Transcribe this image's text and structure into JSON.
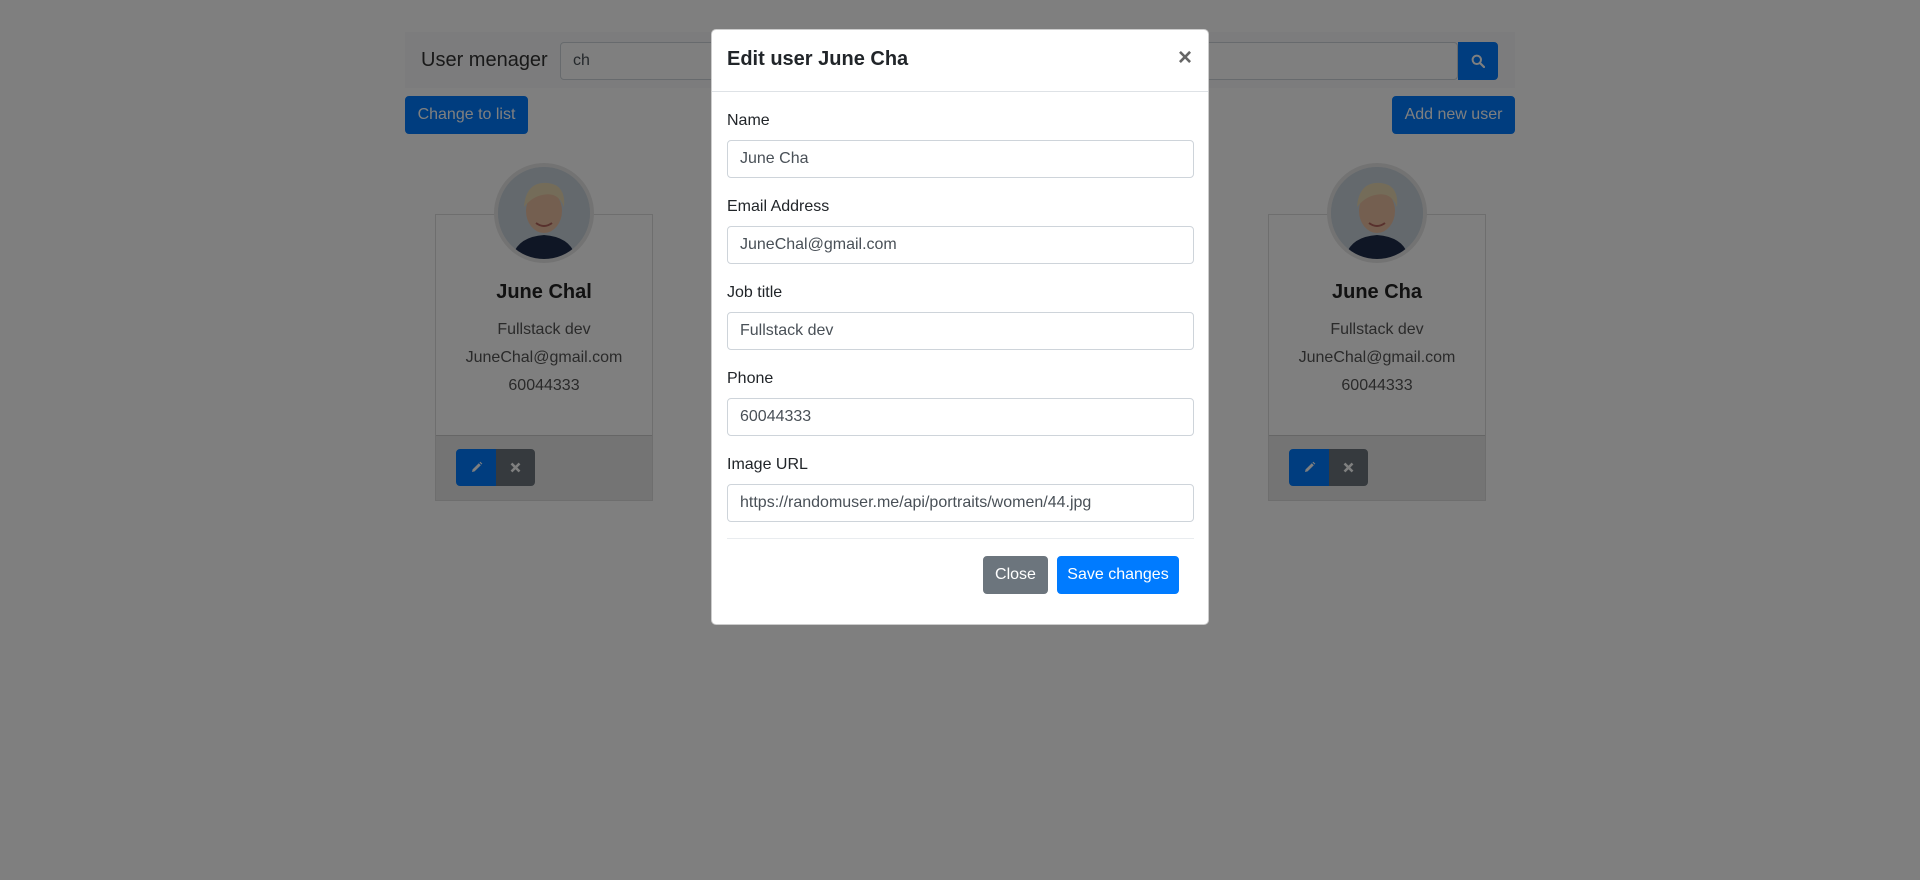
{
  "navbar": {
    "brand": "User menager",
    "search_value": "ch",
    "search_icon": "search-icon"
  },
  "actions": {
    "change_to_list": "Change to list",
    "add_new_user": "Add new user"
  },
  "cards": [
    {
      "name": "June Chal",
      "job": "Fullstack dev",
      "email": "JuneChal@gmail.com",
      "phone": "60044333",
      "edit_icon": "pencil-icon",
      "delete_icon": "times-icon"
    },
    {
      "name": "June Cha",
      "job": "Fullstack dev",
      "email": "JuneChal@gmail.com",
      "phone": "60044333",
      "edit_icon": "pencil-icon",
      "delete_icon": "times-icon"
    }
  ],
  "modal": {
    "title": "Edit user June Cha",
    "close_glyph": "×",
    "fields": [
      {
        "label": "Name",
        "value": "June Cha"
      },
      {
        "label": "Email Address",
        "value": "JuneChal@gmail.com"
      },
      {
        "label": "Job title",
        "value": "Fullstack dev"
      },
      {
        "label": "Phone",
        "value": "60044333"
      },
      {
        "label": "Image URL",
        "value": "https://randomuser.me/api/portraits/women/44.jpg"
      }
    ],
    "close_label": "Close",
    "save_label": "Save changes"
  },
  "colors": {
    "primary": "#007bff",
    "secondary": "#6c757d",
    "backdrop": "rgba(0,0,0,0.5)"
  }
}
